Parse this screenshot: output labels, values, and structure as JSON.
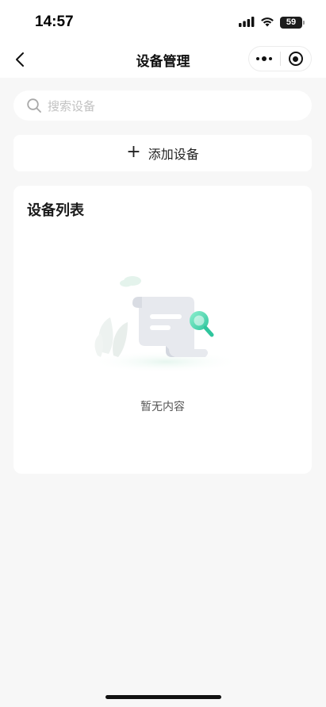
{
  "status_bar": {
    "time": "14:57",
    "battery": "59",
    "icons": [
      "cellular-signal-icon",
      "wifi-icon",
      "battery-icon"
    ]
  },
  "nav": {
    "title": "设备管理",
    "back_icon": "chevron-left-icon",
    "menu_icon": "more-dots-icon",
    "close_icon": "record-circle-icon"
  },
  "search": {
    "placeholder": "搜索设备",
    "icon": "search-icon"
  },
  "add_device": {
    "icon": "plus-icon",
    "label": "添加设备"
  },
  "device_list": {
    "title": "设备列表",
    "items": [],
    "empty_text": "暂无内容",
    "empty_illustration": "empty-document-search-illustration"
  },
  "colors": {
    "page_background": "#f7f7f7",
    "card_background": "#ffffff",
    "accent_green": "#3cc9a2",
    "placeholder_text": "#c2c2c2"
  }
}
